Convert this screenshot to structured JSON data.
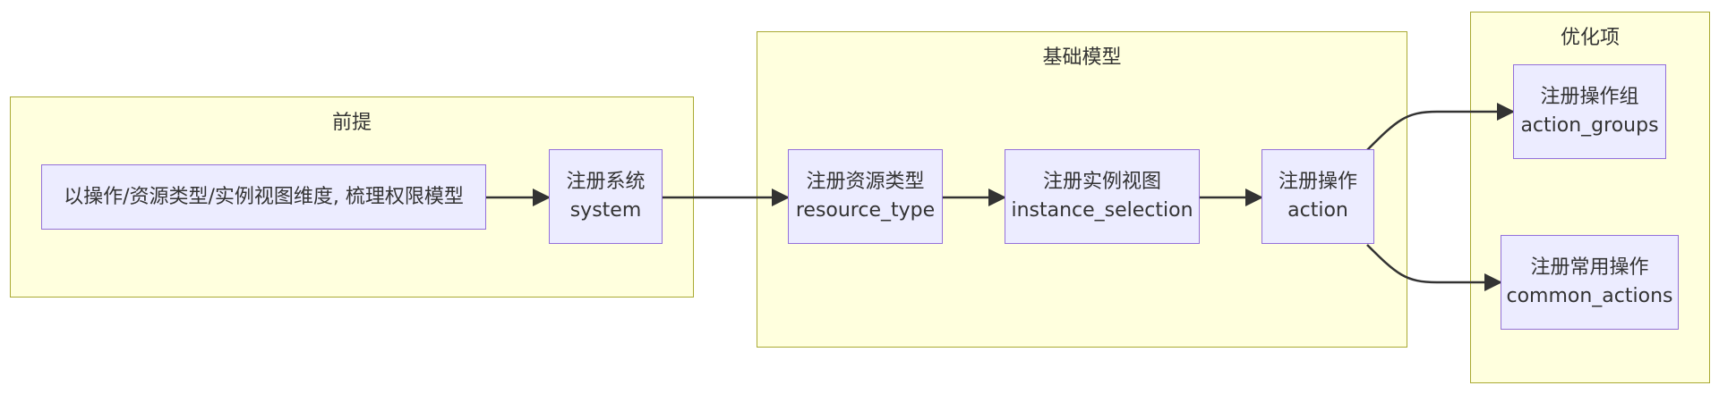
{
  "clusters": {
    "prereq": {
      "title": "前提"
    },
    "base": {
      "title": "基础模型"
    },
    "optim": {
      "title": "优化项"
    }
  },
  "nodes": {
    "sort_model": {
      "line1": "以操作/资源类型/实例视图维度, 梳理权限模型"
    },
    "register_system": {
      "line1": "注册系统",
      "line2": "system"
    },
    "register_resource_type": {
      "line1": "注册资源类型",
      "line2": "resource_type"
    },
    "register_instance_view": {
      "line1": "注册实例视图",
      "line2": "instance_selection"
    },
    "register_action": {
      "line1": "注册操作",
      "line2": "action"
    },
    "register_action_groups": {
      "line1": "注册操作组",
      "line2": "action_groups"
    },
    "register_common_actions": {
      "line1": "注册常用操作",
      "line2": "common_actions"
    }
  },
  "colors": {
    "cluster_fill": "#ffffde",
    "cluster_border": "#aaaa33",
    "node_fill": "#ececff",
    "node_border": "#9370db",
    "edge": "#333333"
  }
}
